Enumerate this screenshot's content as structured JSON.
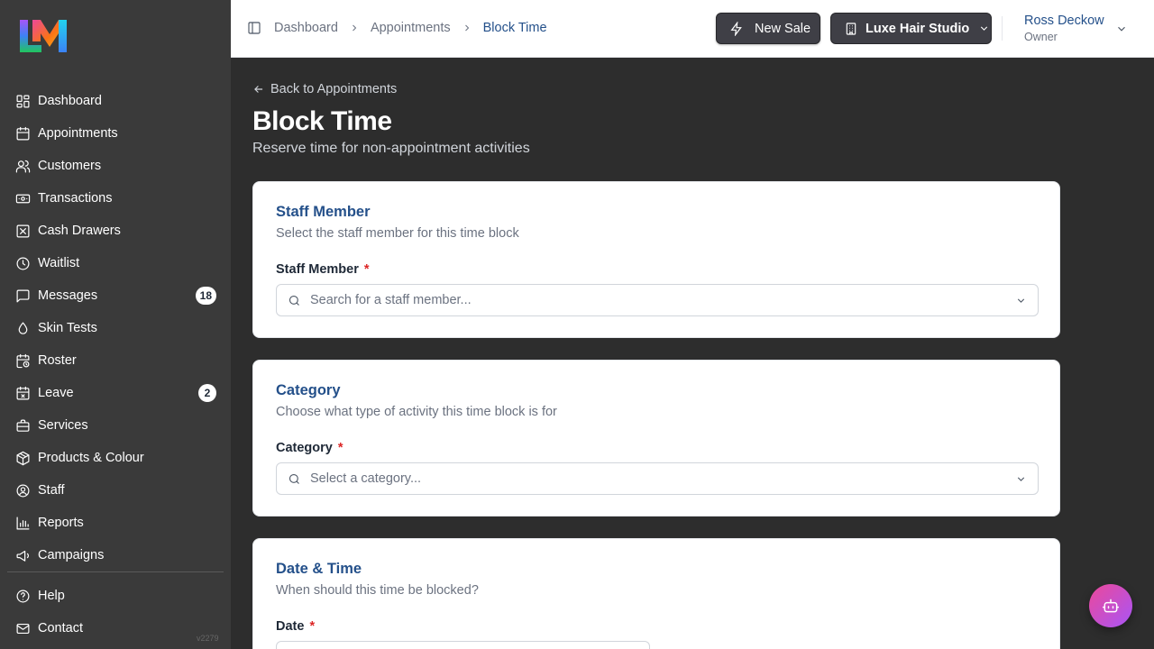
{
  "sidebar": {
    "items": [
      {
        "label": "Dashboard",
        "icon": "dashboard-icon"
      },
      {
        "label": "Appointments",
        "icon": "calendar-icon"
      },
      {
        "label": "Customers",
        "icon": "users-icon"
      },
      {
        "label": "Transactions",
        "icon": "banknote-icon"
      },
      {
        "label": "Cash Drawers",
        "icon": "cash-drawer-icon"
      },
      {
        "label": "Waitlist",
        "icon": "clock-icon"
      },
      {
        "label": "Messages",
        "icon": "message-icon",
        "badge": "18"
      },
      {
        "label": "Skin Tests",
        "icon": "droplet-icon"
      },
      {
        "label": "Roster",
        "icon": "calendar-clock-icon"
      },
      {
        "label": "Leave",
        "icon": "calendar-x-icon",
        "badge": "2"
      },
      {
        "label": "Services",
        "icon": "briefcase-icon"
      },
      {
        "label": "Products & Colour",
        "icon": "package-icon"
      },
      {
        "label": "Staff",
        "icon": "user-circle-icon"
      },
      {
        "label": "Reports",
        "icon": "bar-chart-icon"
      },
      {
        "label": "Campaigns",
        "icon": "megaphone-icon"
      }
    ],
    "bottom_items": [
      {
        "label": "Help",
        "icon": "help-circle-icon"
      },
      {
        "label": "Contact",
        "icon": "mail-icon"
      }
    ],
    "version": "v2279"
  },
  "header": {
    "breadcrumb": [
      "Dashboard",
      "Appointments",
      "Block Time"
    ],
    "new_sale_label": "New Sale",
    "studio_label": "Luxe Hair Studio",
    "user_name": "Ross Deckow",
    "user_role": "Owner"
  },
  "main": {
    "back_label": "Back to Appointments",
    "title": "Block Time",
    "subtitle": "Reserve time for non-appointment activities",
    "cards": [
      {
        "title": "Staff Member",
        "description": "Select the staff member for this time block",
        "field_label": "Staff Member",
        "required_mark": "*",
        "placeholder": "Search for a staff member..."
      },
      {
        "title": "Category",
        "description": "Choose what type of activity this time block is for",
        "field_label": "Category",
        "required_mark": "*",
        "placeholder": "Select a category..."
      },
      {
        "title": "Date & Time",
        "description": "When should this time be blocked?",
        "field_label": "Date",
        "required_mark": "*"
      }
    ]
  },
  "colors": {
    "sidebar_bg": "#3a3a3a",
    "main_bg": "#2d2d2d",
    "accent": "#24508a",
    "required": "#dc2626",
    "fab_gradient": [
      "#ec4899",
      "#a855f7"
    ]
  }
}
